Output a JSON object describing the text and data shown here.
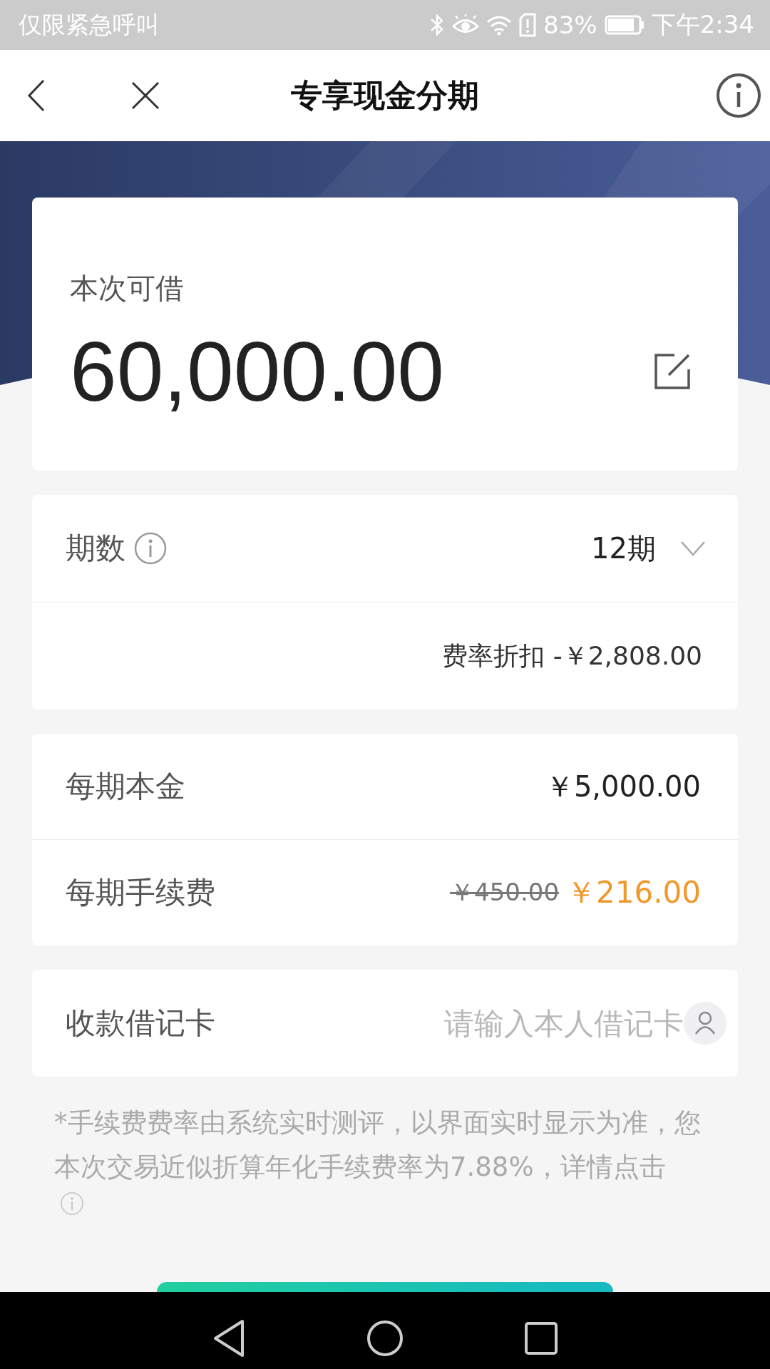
{
  "status_bar": {
    "notice": "仅限紧急呼叫",
    "battery_percent": "83%",
    "time": "下午2:34"
  },
  "header": {
    "title": "专享现金分期"
  },
  "amount_card": {
    "label": "本次可借",
    "amount": "60,000.00"
  },
  "term_card": {
    "label": "期数",
    "value": "12期",
    "discount": "费率折扣 -￥2,808.00"
  },
  "detail_rows": [
    {
      "label": "每期本金",
      "kind": "plain",
      "value": "￥5,000.00"
    },
    {
      "label": "每期手续费",
      "kind": "discounted",
      "old_value": "￥450.00",
      "value": "￥216.00"
    }
  ],
  "card_field": {
    "label": "收款借记卡",
    "placeholder": "请输入本人借记卡"
  },
  "note": "*手续费费率由系统实时测评，以界面实时显示为准，您本次交易近似折算年化手续费率为7.88%，详情点击"
}
